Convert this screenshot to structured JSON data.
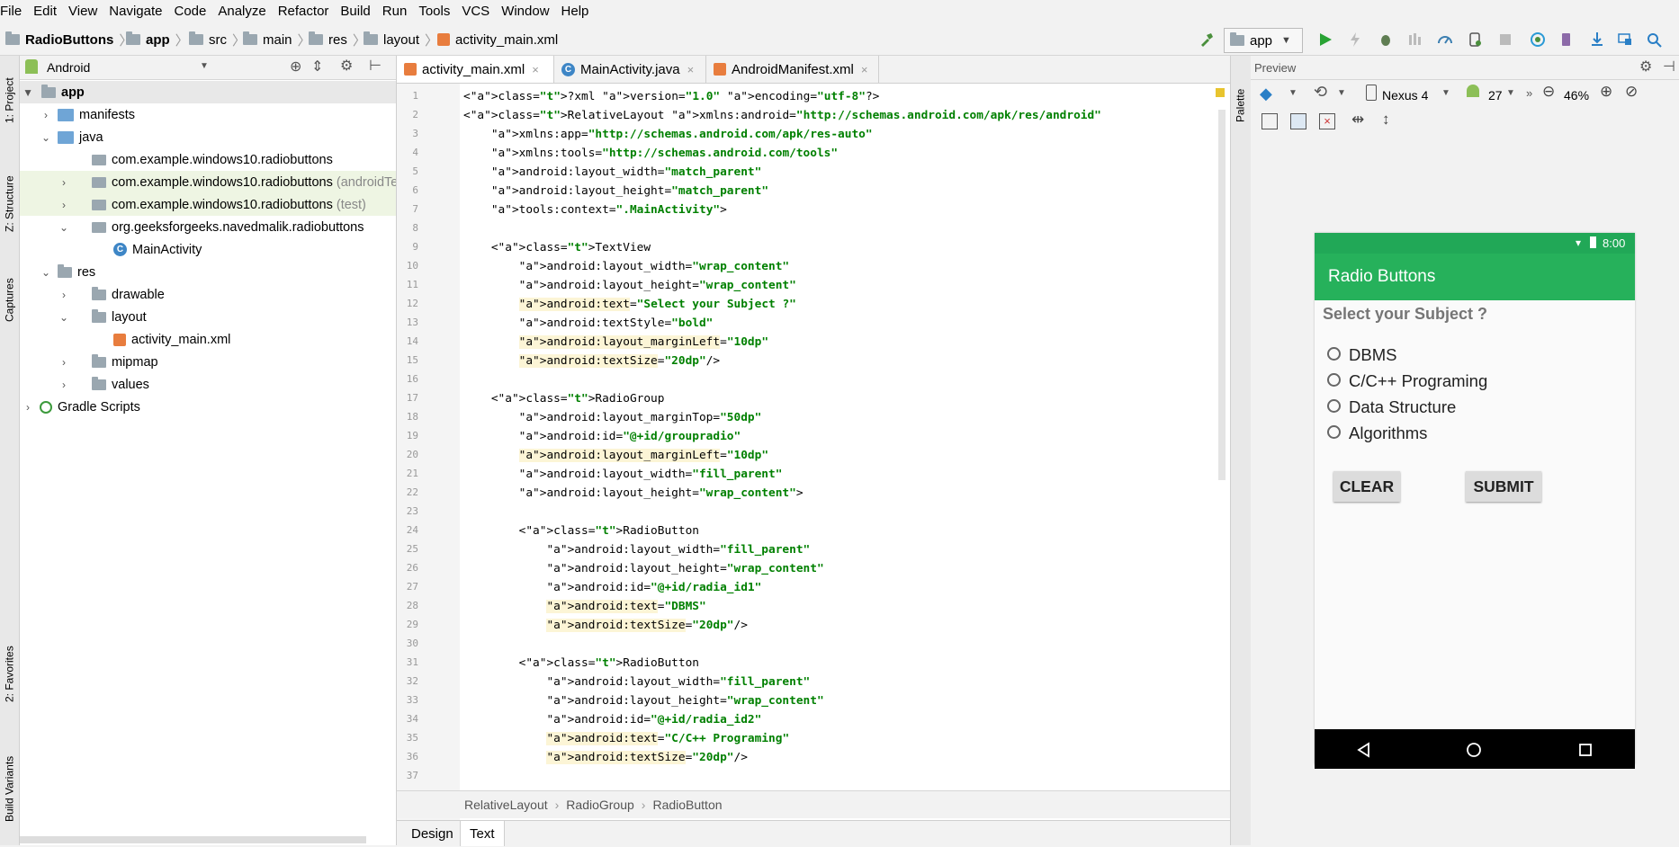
{
  "menu": [
    "File",
    "Edit",
    "View",
    "Navigate",
    "Code",
    "Analyze",
    "Refactor",
    "Build",
    "Run",
    "Tools",
    "VCS",
    "Window",
    "Help"
  ],
  "breadcrumbs": [
    "RadioButtons",
    "app",
    "src",
    "main",
    "res",
    "layout",
    "activity_main.xml"
  ],
  "toolbar": {
    "run_config": "app"
  },
  "left_strip": {
    "project": "1: Project",
    "structure": "Z: Structure",
    "captures": "Captures",
    "favorites": "2: Favorites",
    "build_variants": "Build Variants"
  },
  "project_panel": {
    "view_mode": "Android",
    "tree": [
      {
        "label": "app",
        "bold": true
      },
      {
        "label": "manifests"
      },
      {
        "label": "java"
      },
      {
        "label": "com.example.windows10.radiobuttons"
      },
      {
        "label": "com.example.windows10.radiobuttons",
        "suffix": "(androidTest)"
      },
      {
        "label": "com.example.windows10.radiobuttons",
        "suffix": "(test)"
      },
      {
        "label": "org.geeksforgeeks.navedmalik.radiobuttons"
      },
      {
        "label": "MainActivity"
      },
      {
        "label": "res"
      },
      {
        "label": "drawable"
      },
      {
        "label": "layout"
      },
      {
        "label": "activity_main.xml"
      },
      {
        "label": "mipmap"
      },
      {
        "label": "values"
      },
      {
        "label": "Gradle Scripts"
      }
    ]
  },
  "editor_tabs": [
    "activity_main.xml",
    "MainActivity.java",
    "AndroidManifest.xml"
  ],
  "code_lines": [
    "<?xml version=\"1.0\" encoding=\"utf-8\"?>",
    "<RelativeLayout xmlns:android=\"http://schemas.android.com/apk/res/android\"",
    "    xmlns:app=\"http://schemas.android.com/apk/res-auto\"",
    "    xmlns:tools=\"http://schemas.android.com/tools\"",
    "    android:layout_width=\"match_parent\"",
    "    android:layout_height=\"match_parent\"",
    "    tools:context=\".MainActivity\">",
    "",
    "    <TextView",
    "        android:layout_width=\"wrap_content\"",
    "        android:layout_height=\"wrap_content\"",
    "        android:text=\"Select your Subject ?\"",
    "        android:textStyle=\"bold\"",
    "        android:layout_marginLeft=\"10dp\"",
    "        android:textSize=\"20dp\"/>",
    "",
    "    <RadioGroup",
    "        android:layout_marginTop=\"50dp\"",
    "        android:id=\"@+id/groupradio\"",
    "        android:layout_marginLeft=\"10dp\"",
    "        android:layout_width=\"fill_parent\"",
    "        android:layout_height=\"wrap_content\">",
    "",
    "        <RadioButton",
    "            android:layout_width=\"fill_parent\"",
    "            android:layout_height=\"wrap_content\"",
    "            android:id=\"@+id/radia_id1\"",
    "            android:text=\"DBMS\"",
    "            android:textSize=\"20dp\"/>",
    "",
    "        <RadioButton",
    "            android:layout_width=\"fill_parent\"",
    "            android:layout_height=\"wrap_content\"",
    "            android:id=\"@+id/radia_id2\"",
    "            android:text=\"C/C++ Programing\"",
    "            android:textSize=\"20dp\"/>",
    "",
    "        <RadioButton"
  ],
  "highlighted_lines": [
    12,
    14,
    15,
    20,
    28,
    29,
    35,
    36
  ],
  "editor_breadcrumb": [
    "RelativeLayout",
    "RadioGroup",
    "RadioButton"
  ],
  "bottom_tabs": [
    "Design",
    "Text"
  ],
  "preview": {
    "title": "Preview",
    "palette_label": "Palette",
    "device": "Nexus 4",
    "api": "27",
    "zoom": "46%",
    "phone": {
      "time": "8:00",
      "app_title": "Radio Buttons",
      "prompt": "Select your Subject ?",
      "options": [
        "DBMS",
        "C/C++ Programing",
        "Data Structure",
        "Algorithms"
      ],
      "clear_label": "CLEAR",
      "submit_label": "SUBMIT"
    },
    "colors": {
      "status": "#21a857",
      "appbar": "#26b15b"
    }
  }
}
